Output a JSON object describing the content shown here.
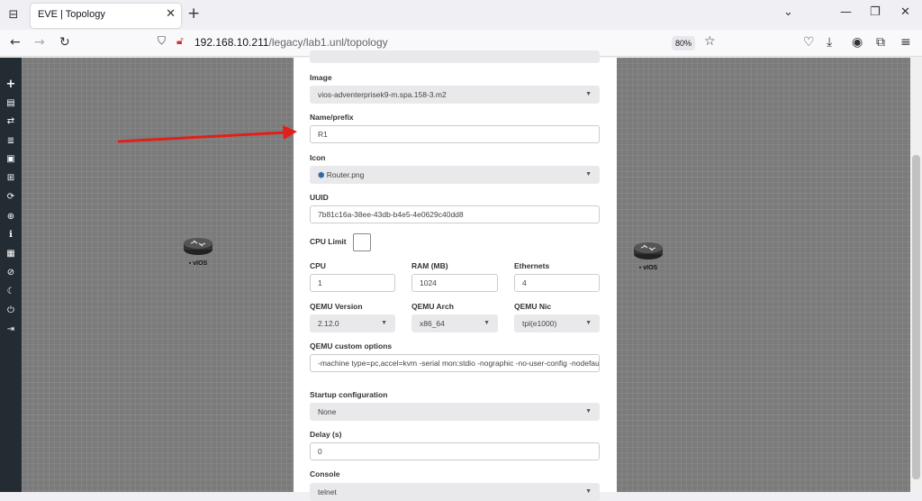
{
  "browser": {
    "tab_title": "EVE | Topology",
    "url_host": "192.168.10.211",
    "url_path": "/legacy/lab1.unl/topology",
    "zoom": "80%"
  },
  "nodes": [
    {
      "label": "vIOS"
    },
    {
      "label": "vIOS"
    }
  ],
  "form": {
    "image_label": "Image",
    "image_value": "vios-adventerprisek9-m.spa.158-3.m2",
    "name_label": "Name/prefix",
    "name_value": "R1",
    "icon_label": "Icon",
    "icon_value": "Router.png",
    "uuid_label": "UUID",
    "uuid_value": "7b81c16a-38ee-43db-b4e5-4e0629c40dd8",
    "cpu_limit_label": "CPU Limit",
    "cpu_label": "CPU",
    "cpu_value": "1",
    "ram_label": "RAM (MB)",
    "ram_value": "1024",
    "ethernets_label": "Ethernets",
    "ethernets_value": "4",
    "qemu_version_label": "QEMU Version",
    "qemu_version_value": "2.12.0",
    "qemu_arch_label": "QEMU Arch",
    "qemu_arch_value": "x86_64",
    "qemu_nic_label": "QEMU Nic",
    "qemu_nic_value": "tpl(e1000)",
    "qemu_opts_label": "QEMU custom options",
    "qemu_opts_value": "-machine type=pc,accel=kvm -serial mon:stdio -nographic -no-user-config -nodefaults",
    "startup_label": "Startup configuration",
    "startup_value": "None",
    "delay_label": "Delay (s)",
    "delay_value": "0",
    "console_label": "Console",
    "console_value": "telnet"
  },
  "colors": {
    "annotation_arrow": "#e0201a",
    "sidebar": "#232c33"
  }
}
